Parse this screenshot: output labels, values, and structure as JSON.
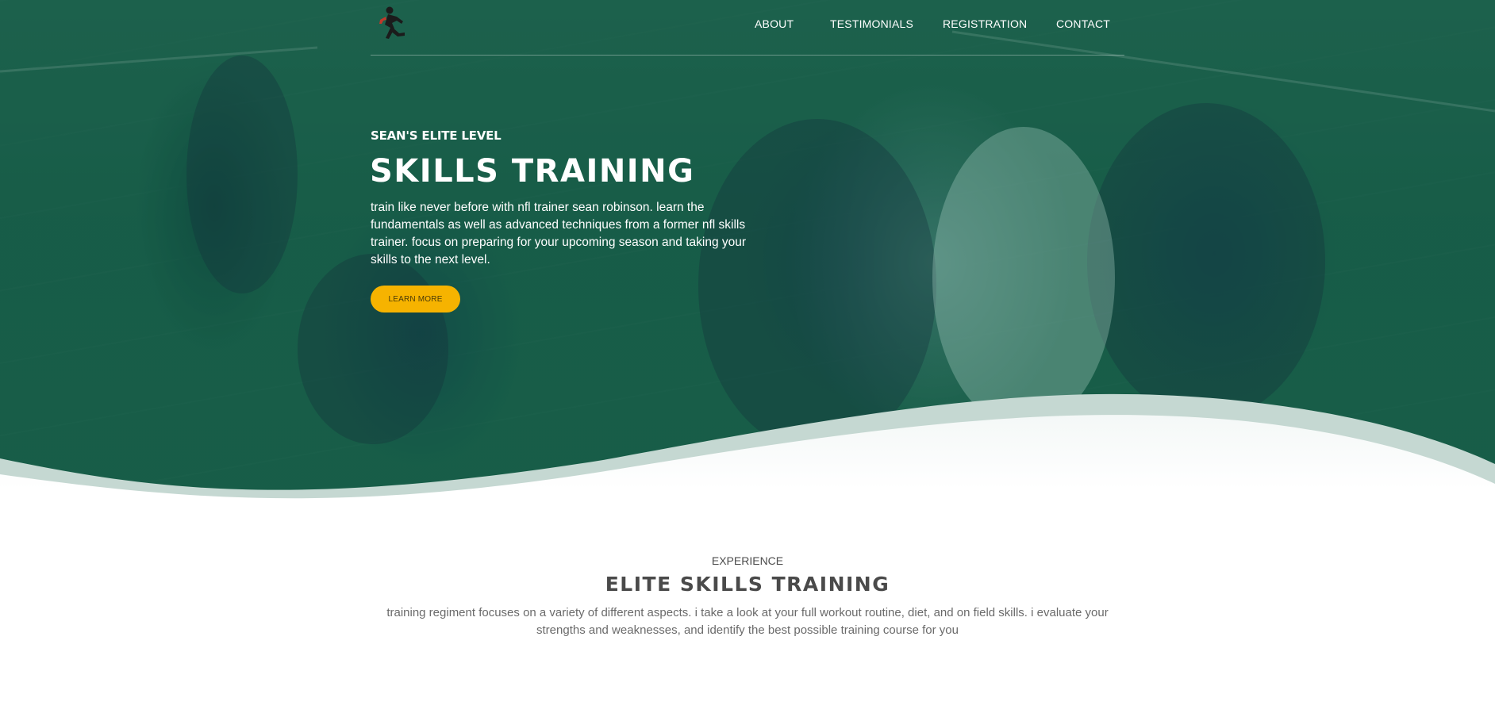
{
  "colors": {
    "overlay": "#0e5a48",
    "accent": "#f6b300",
    "wave_band": "#c5d8d2",
    "heading_dark": "#4a4a4a",
    "body_gray": "#6a6a6a"
  },
  "logo": {
    "icon": "running-player-icon"
  },
  "nav": {
    "items": [
      {
        "label": "ABOUT"
      },
      {
        "label": "TESTIMONIALS"
      },
      {
        "label": "REGISTRATION"
      },
      {
        "label": "CONTACT"
      }
    ]
  },
  "hero": {
    "eyebrow": "SEAN'S ELITE LEVEL",
    "title": "SKILLS TRAINING",
    "text": "train like never before with nfl trainer sean robinson. learn the fundamentals as well as advanced techniques from a former nfl skills trainer. focus on preparing for your upcoming season and taking your skills to the next level.",
    "button_label": "LEARN MORE",
    "background": "football-practice-photo"
  },
  "experience": {
    "eyebrow": "EXPERIENCE",
    "title": "ELITE SKILLS TRAINING",
    "text": "training regiment focuses on a variety of different aspects. i take a look at your full workout routine, diet, and on field skills. i evaluate your strengths and weaknesses, and identify the best possible training course for you"
  }
}
